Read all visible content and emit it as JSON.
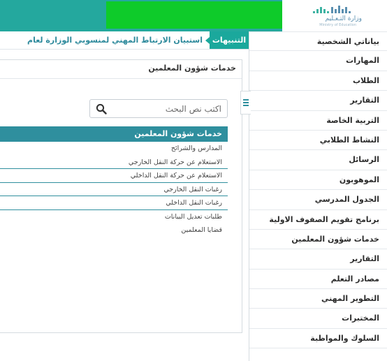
{
  "header": {
    "logo_text": "وزارة التـعـليم",
    "logo_subtext": "Ministry of Education"
  },
  "alert": {
    "label": "التنبيهات",
    "text": "استبيان الارتباط المهني لمنسوبي الوزارة لعام"
  },
  "sidebar": {
    "items": [
      {
        "label": "بياناتي الشخصية"
      },
      {
        "label": "المهارات"
      },
      {
        "label": "الطلاب"
      },
      {
        "label": "التقارير"
      },
      {
        "label": "التربية الخاصة"
      },
      {
        "label": "النشاط الطلابي"
      },
      {
        "label": "الرسائل"
      },
      {
        "label": "الموهوبون"
      },
      {
        "label": "الجدول المدرسي"
      },
      {
        "label": "برنامج تقويم الصفوف الاولية"
      },
      {
        "label": "خدمات شؤون المعلمين"
      },
      {
        "label": "التقارير"
      },
      {
        "label": "مصادر التعلم"
      },
      {
        "label": "التطوير المهني"
      },
      {
        "label": "المختبرات"
      },
      {
        "label": "السلوك والمواظبة"
      }
    ]
  },
  "main": {
    "title": "خدمات شؤون المعلمين",
    "search_placeholder": "اكتب نص البحث",
    "list_header": "خدمات شؤون المعلمين",
    "items": [
      {
        "label": "المدارس والشرائح"
      },
      {
        "label": "الاستعلام عن حركة النقل الخارجي"
      },
      {
        "label": "الاستعلام عن حركة النقل الداخلي"
      },
      {
        "label": "رغبات النقل الخارجي"
      },
      {
        "label": "رغبات النقل الداخلي"
      },
      {
        "label": "طلبات تعديل البيانات"
      },
      {
        "label": "قضايا المعلمين"
      }
    ]
  },
  "colors": {
    "topbar": "#24a89e",
    "green_block": "#0ecb2a",
    "accent": "#1ba89c",
    "list_header": "#2f8f9e"
  }
}
